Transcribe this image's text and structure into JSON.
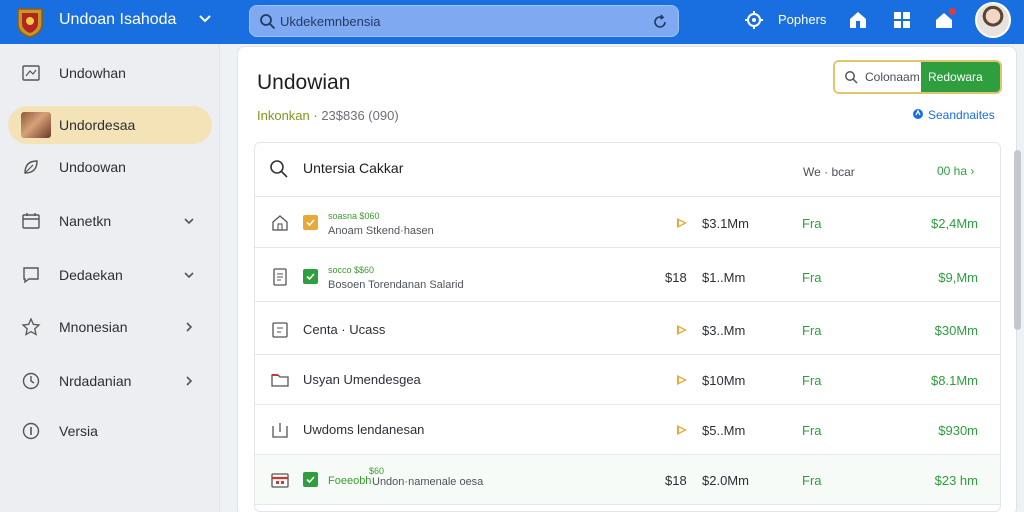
{
  "header": {
    "app_name": "Undoan Isahoda",
    "search_placeholder": "Ukdekemnbensia",
    "account_label": "Pophers"
  },
  "sidebar": {
    "items": [
      {
        "label": "Undowhan",
        "icon": "photo-icon",
        "active": false,
        "chevron": ""
      },
      {
        "label": "Undordesaa",
        "icon": "thumbnail",
        "active": true,
        "chevron": ""
      },
      {
        "label": "Undoowan",
        "icon": "leaf-icon",
        "active": false,
        "chevron": ""
      },
      {
        "label": "Nanetkn",
        "icon": "calendar-icon",
        "active": false,
        "chevron": "down"
      },
      {
        "label": "Dedaekan",
        "icon": "chat-icon",
        "active": false,
        "chevron": "down"
      },
      {
        "label": "Mnonesian",
        "icon": "star-icon",
        "active": false,
        "chevron": "right"
      },
      {
        "label": "Nrdadanian",
        "icon": "clock-icon",
        "active": false,
        "chevron": "right"
      },
      {
        "label": "Versia",
        "icon": "info-icon",
        "active": false,
        "chevron": ""
      }
    ]
  },
  "main": {
    "title": "Undowian",
    "subtitle_green": "Inkonkan",
    "subtitle_gray": " · 23$836  (090)",
    "btn_secondary": "Colonaam",
    "btn_primary": "Redowara",
    "help_link": "Seandnaites"
  },
  "panel": {
    "title": "Untersia Cakkar",
    "meta": "We · bcar",
    "link": "00 ha ›",
    "rows": [
      {
        "type": "tagged",
        "check": "orange",
        "tag": "soasna $060",
        "desc": "Anoam  Stkend·hasen",
        "qty": "",
        "price": "$3.1Mm",
        "status": "Fra",
        "total": "$2,4Mm",
        "play": true
      },
      {
        "type": "tagged",
        "check": "green",
        "tag": "socco $$60",
        "desc": "Bosoen  Torendanan Salarid",
        "qty": "$18",
        "price": "$1..Mm",
        "status": "Fra",
        "total": "$9,Mm",
        "play": false
      },
      {
        "type": "plain",
        "name": "Centa · Ucass",
        "qty": "",
        "price": "$3..Mm",
        "status": "Fra",
        "total": "$30Mm",
        "play": true
      },
      {
        "type": "plain",
        "name": "Usyan  Umendesgea",
        "qty": "",
        "price": "$10Mm",
        "status": "Fra",
        "total": "$8.1Mm",
        "play": true
      },
      {
        "type": "plain",
        "name": "Uwdoms  lendanesan",
        "qty": "",
        "price": "$5..Mm",
        "status": "Fra",
        "total": "$930m",
        "play": true
      },
      {
        "type": "bold",
        "check": "green",
        "tag": "$60",
        "name": "Foeeobh",
        "desc": "Undon·namenale oesa",
        "qty": "$18",
        "price": "$2.0Mm",
        "status": "Fra",
        "total": "$23 hm",
        "play": false
      }
    ]
  },
  "colors": {
    "topbar": "#1a6fe0",
    "accent_green": "#2e9e3e",
    "accent_orange": "#e7a93a",
    "active_nav": "#f5e3b8"
  }
}
